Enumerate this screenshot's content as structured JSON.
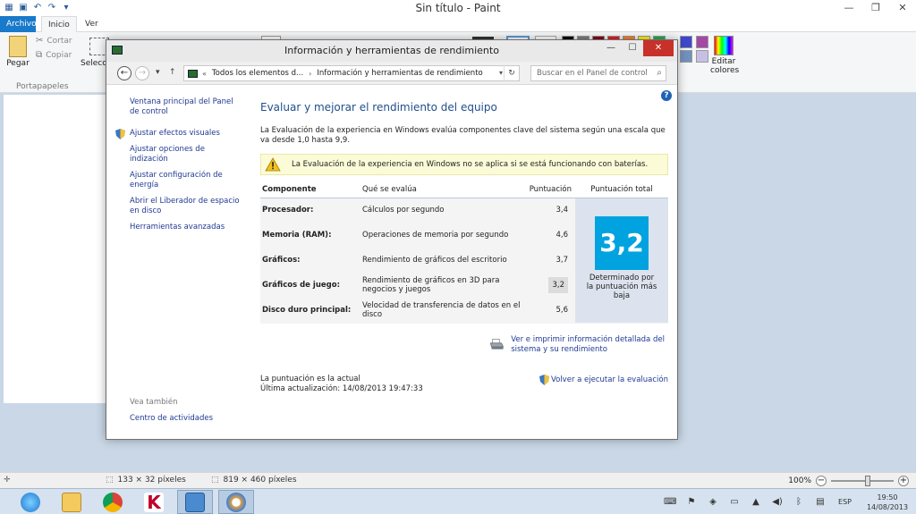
{
  "paint": {
    "title": "Sin título - Paint",
    "tabs": {
      "file": "Archivo",
      "home": "Inicio",
      "view": "Ver"
    },
    "ribbon": {
      "paste": "Pegar",
      "cut": "Cortar",
      "copy": "Copiar",
      "clipboard_group": "Portapapeles",
      "select": "Selecci",
      "edit_colors": "Editar colores"
    },
    "status": {
      "selection_size": "133 × 32 píxeles",
      "image_size": "819 × 460 píxeles",
      "zoom": "100%"
    },
    "palette": [
      "#000000",
      "#7f7f7f",
      "#880015",
      "#ed1c24",
      "#ff7f27",
      "#fff200",
      "#22b14c",
      "#ffffff",
      "#c3c3c3",
      "#b97a57",
      "#ffaec9",
      "#ffc90e",
      "#efe4b0",
      "#b5e61d"
    ],
    "palette_extra": [
      "#3f48cc",
      "#a349a4",
      "#7092be",
      "#c8bfe7"
    ]
  },
  "window": {
    "title": "Información y herramientas de rendimiento",
    "address": {
      "crumb1": "Todos los elementos d...",
      "crumb2": "Información y herramientas de rendimiento"
    },
    "search_placeholder": "Buscar en el Panel de control",
    "sidebar": {
      "home": "Ventana principal del Panel de control",
      "links": [
        "Ajustar efectos visuales",
        "Ajustar opciones de indización",
        "Ajustar configuración de energía",
        "Abrir el Liberador de espacio en disco",
        "Herramientas avanzadas"
      ],
      "see_also": "Vea también",
      "action_center": "Centro de actividades"
    },
    "main": {
      "heading": "Evaluar y mejorar el rendimiento del equipo",
      "description": "La Evaluación de la experiencia en Windows evalúa componentes clave del sistema según una escala que va desde 1,0 hasta 9,9.",
      "warning": "La Evaluación de la experiencia en Windows no se aplica si se está funcionando con baterías.",
      "columns": {
        "component": "Componente",
        "what": "Qué se evalúa",
        "score": "Puntuación",
        "total": "Puntuación total"
      },
      "rows": [
        {
          "component": "Procesador:",
          "what": "Cálculos por segundo",
          "score": "3,4"
        },
        {
          "component": "Memoria (RAM):",
          "what": "Operaciones de memoria por segundo",
          "score": "4,6"
        },
        {
          "component": "Gráficos:",
          "what": "Rendimiento de gráficos del escritorio",
          "score": "3,7"
        },
        {
          "component": "Gráficos de juego:",
          "what": "Rendimiento de gráficos en 3D para negocios y juegos",
          "score": "3,2"
        },
        {
          "component": "Disco duro principal:",
          "what": "Velocidad de transferencia de datos en el disco",
          "score": "5,6"
        }
      ],
      "total_score": "3,2",
      "total_note": "Determinado por la puntuación más baja",
      "print_link": "Ver e imprimir información detallada del sistema y su rendimiento",
      "status_current": "La puntuación es la actual",
      "last_update": "Última actualización: 14/08/2013 19:47:33",
      "rerun": "Volver a ejecutar la evaluación"
    }
  },
  "taskbar": {
    "language": "ESP",
    "time": "19:50",
    "date": "14/08/2013"
  }
}
